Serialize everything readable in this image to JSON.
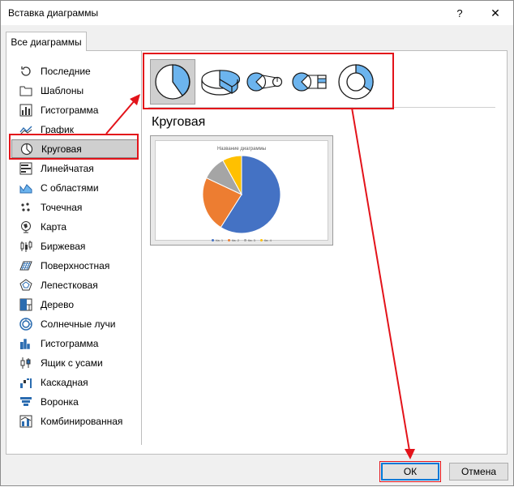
{
  "dialog": {
    "title": "Вставка диаграммы",
    "help_glyph": "?",
    "close_glyph": "✕"
  },
  "tab": {
    "label": "Все диаграммы"
  },
  "sidebar": {
    "items": [
      {
        "label": "Последние",
        "icon": "recent-icon"
      },
      {
        "label": "Шаблоны",
        "icon": "folder-icon"
      },
      {
        "label": "Гистограмма",
        "icon": "column-chart-icon"
      },
      {
        "label": "График",
        "icon": "line-chart-icon"
      },
      {
        "label": "Круговая",
        "icon": "pie-chart-icon",
        "selected": true
      },
      {
        "label": "Линейчатая",
        "icon": "bar-chart-icon"
      },
      {
        "label": "С областями",
        "icon": "area-chart-icon"
      },
      {
        "label": "Точечная",
        "icon": "scatter-chart-icon"
      },
      {
        "label": "Карта",
        "icon": "map-chart-icon"
      },
      {
        "label": "Биржевая",
        "icon": "stock-chart-icon"
      },
      {
        "label": "Поверхностная",
        "icon": "surface-chart-icon"
      },
      {
        "label": "Лепестковая",
        "icon": "radar-chart-icon"
      },
      {
        "label": "Дерево",
        "icon": "treemap-chart-icon"
      },
      {
        "label": "Солнечные лучи",
        "icon": "sunburst-chart-icon"
      },
      {
        "label": "Гистограмма",
        "icon": "histogram-chart-icon"
      },
      {
        "label": "Ящик с усами",
        "icon": "boxwhisker-chart-icon"
      },
      {
        "label": "Каскадная",
        "icon": "waterfall-chart-icon"
      },
      {
        "label": "Воронка",
        "icon": "funnel-chart-icon"
      },
      {
        "label": "Комбинированная",
        "icon": "combo-chart-icon"
      }
    ]
  },
  "subtypes": [
    {
      "icon": "pie-subtype-icon",
      "selected": true
    },
    {
      "icon": "pie-3d-subtype-icon"
    },
    {
      "icon": "pie-of-pie-subtype-icon"
    },
    {
      "icon": "bar-of-pie-subtype-icon"
    },
    {
      "icon": "doughnut-subtype-icon"
    }
  ],
  "main": {
    "chart_name": "Круговая",
    "preview_title": "Название диаграммы",
    "legend": [
      "Кв. 1",
      "Кв. 2",
      "Кв. 3",
      "Кв. 4"
    ]
  },
  "buttons": {
    "ok": "ОК",
    "cancel": "Отмена"
  },
  "colors": {
    "accent_red": "#e3131a",
    "slice_blue": "#4472c4",
    "slice_orange": "#ed7d31",
    "slice_gray": "#a5a5a5",
    "slice_yellow": "#ffc000",
    "subtype_blue": "#6cb4ee",
    "focus_blue": "#0078d7"
  },
  "chart_data": {
    "type": "pie",
    "title": "Название диаграммы",
    "categories": [
      "Кв. 1",
      "Кв. 2",
      "Кв. 3",
      "Кв. 4"
    ],
    "values": [
      59,
      23,
      10,
      8
    ]
  }
}
